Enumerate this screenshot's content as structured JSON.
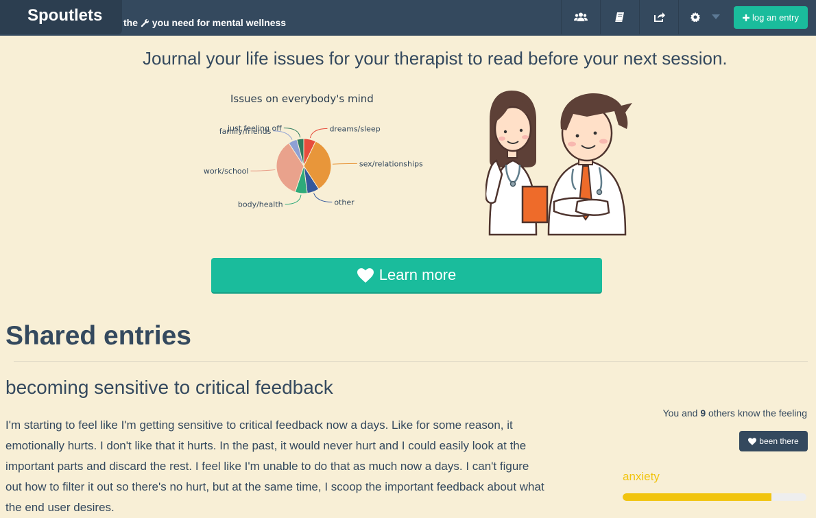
{
  "nav": {
    "brand": "Spoutlets",
    "tagline_pre": "the",
    "tagline_post": "you need for mental wellness",
    "icons": [
      "users-icon",
      "book-icon",
      "share-icon",
      "gear-icon"
    ],
    "log_button": "log an entry"
  },
  "hero": {
    "headline": "Journal your life issues for your therapist to read before your next session.",
    "learn_more": "Learn more"
  },
  "chart_data": {
    "type": "pie",
    "title": "Issues on everybody's mind",
    "slices": [
      {
        "label": "dreams/sleep",
        "value": 7,
        "color": "#e74c3c"
      },
      {
        "label": "sex/relationships",
        "value": 33,
        "color": "#e8963a"
      },
      {
        "label": "other",
        "value": 7,
        "color": "#34589c"
      },
      {
        "label": "body/health",
        "value": 7,
        "color": "#2eaa7a"
      },
      {
        "label": "work/school",
        "value": 35,
        "color": "#e9a28c"
      },
      {
        "label": "family/friends",
        "value": 5,
        "color": "#8ea0d4"
      },
      {
        "label": "just feeling off",
        "value": 4,
        "color": "#2f7d5f"
      }
    ]
  },
  "shared": {
    "title": "Shared entries",
    "entry": {
      "title": "becoming sensitive to critical feedback",
      "body": "I'm starting to feel like I'm getting sensitive to critical feedback now a days. Like for some reason, it emotionally hurts. I don't like that it hurts. In the past, it would never hurt and I could easily look at the important parts and discard the rest. I feel like I'm unable to do that as much now a days. I can't figure out how to filter it out so there's no hurt, but at the same time, I scoop the important feedback about what the end user desires.",
      "feeling_pre": "You and",
      "feeling_count": "9",
      "feeling_post": "others know the feeling",
      "been_there": "been there",
      "tag": "anxiety",
      "tag_level": 0.81,
      "tag_color": "#f1c40f"
    }
  }
}
